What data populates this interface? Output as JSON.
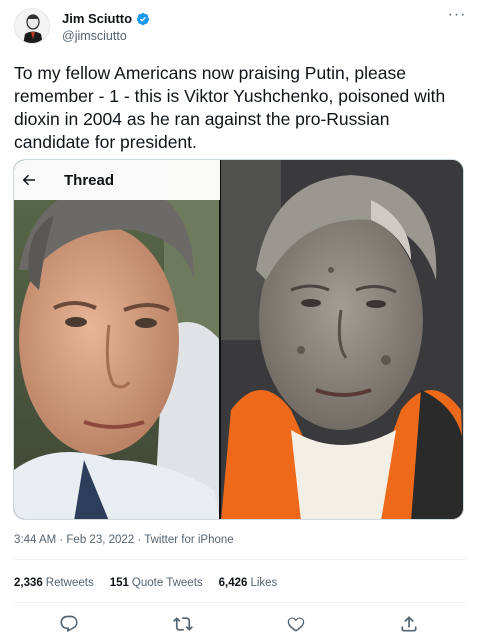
{
  "author": {
    "name": "Jim Sciutto",
    "handle": "@jimsciutto",
    "verified": true,
    "avatar_icon": "avatar-cartoon-icon"
  },
  "tweet": {
    "text": "To my fellow Americans now praising Putin, please remember - 1 - this is Viktor Yushchenko, poisoned with dioxin in 2004 as he ran against the pro-Russian candidate for president."
  },
  "media": {
    "thread_bar": {
      "back_icon": "arrow-left-icon",
      "title": "Thread"
    },
    "images": [
      "photo-before-icon",
      "photo-after-icon"
    ]
  },
  "meta": {
    "time": "3:44 AM",
    "date": "Feb 23, 2022",
    "source": "Twitter for iPhone",
    "line": "3:44 AM · Feb 23, 2022 · Twitter for iPhone"
  },
  "stats": {
    "retweets_count": "2,336",
    "retweets_label": "Retweets",
    "quotes_count": "151",
    "quotes_label": "Quote Tweets",
    "likes_count": "6,426",
    "likes_label": "Likes"
  },
  "actions": [
    "reply-icon",
    "retweet-icon",
    "like-icon",
    "share-icon"
  ],
  "colors": {
    "text": "#0f1419",
    "muted": "#536471",
    "verified_blue": "#1d9bf0",
    "divider": "#eff3f4"
  }
}
